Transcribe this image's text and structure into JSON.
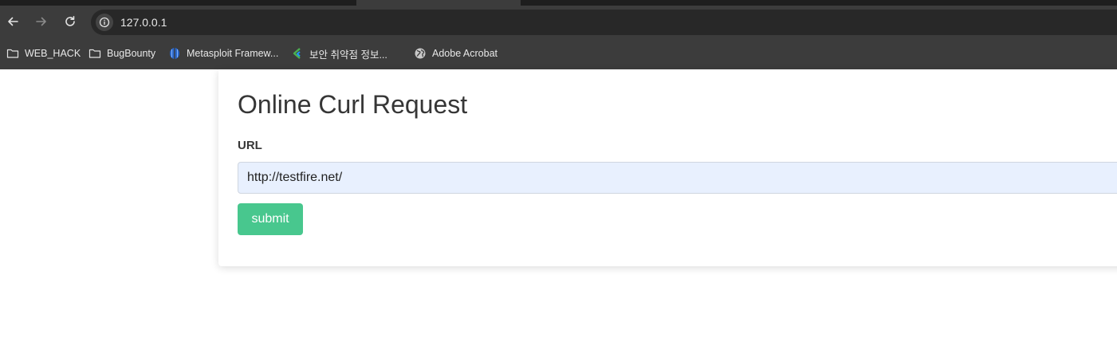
{
  "browser": {
    "address_bar": {
      "url": "127.0.0.1"
    },
    "bookmarks": [
      {
        "label": "WEB_HACK",
        "icon": "folder-icon"
      },
      {
        "label": "BugBounty",
        "icon": "folder-icon"
      },
      {
        "label": "Metasploit Framew...",
        "icon": "metasploit-icon"
      },
      {
        "label": "보안 취약점 정보...",
        "icon": "security-vuln-icon"
      },
      {
        "label": "Adobe Acrobat",
        "icon": "globe-icon"
      }
    ]
  },
  "page": {
    "title": "Online Curl Request",
    "form": {
      "url_label": "URL",
      "url_value": "http://testfire.net/",
      "submit_label": "submit"
    }
  },
  "colors": {
    "submit_button": "#48c78e",
    "input_autofill_bg": "#e8f0fe",
    "browser_toolbar": "#3c3c3c"
  }
}
